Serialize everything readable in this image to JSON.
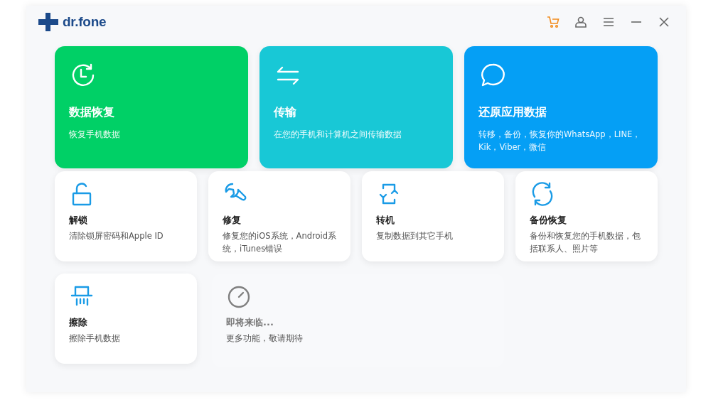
{
  "app": {
    "logo_text": "dr.fone"
  },
  "main_features": [
    {
      "title": "数据恢复",
      "description": "恢复手机数据",
      "color": "#00d066"
    },
    {
      "title": "传输",
      "description": "在您的手机和计算机之间传输数据",
      "color": "#18c8d6"
    },
    {
      "title": "还原应用数据",
      "description": "转移，备份，恢复你的WhatsApp，LINE，Kik，Viber，微信",
      "color": "#059ff5"
    }
  ],
  "tools": [
    {
      "title": "解锁",
      "description": "清除锁屏密码和Apple ID"
    },
    {
      "title": "修复",
      "description": "修复您的iOS系统，Android系统，iTunes错误"
    },
    {
      "title": "转机",
      "description": "复制数据到其它手机"
    },
    {
      "title": "备份恢复",
      "description": "备份和恢复您的手机数据，包括联系人、照片等"
    },
    {
      "title": "擦除",
      "description": "擦除手机数据"
    }
  ],
  "coming_soon": {
    "title": "即将来临...",
    "description": "更多功能，敬请期待"
  }
}
